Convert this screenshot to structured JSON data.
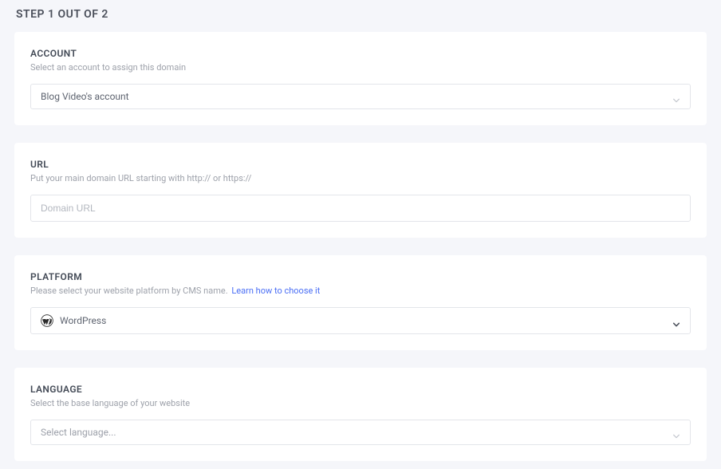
{
  "step_title": "STEP 1 OUT OF 2",
  "account": {
    "heading": "ACCOUNT",
    "subtext": "Select an account to assign this domain",
    "selected": "Blog Video's account"
  },
  "url": {
    "heading": "URL",
    "subtext": "Put your main domain URL starting with http:// or https://",
    "placeholder": "Domain URL"
  },
  "platform": {
    "heading": "PLATFORM",
    "subtext": "Please select your website platform by CMS name.",
    "link_text": "Learn how to choose it",
    "selected": "WordPress",
    "icon": "wordpress-icon"
  },
  "language": {
    "heading": "LANGUAGE",
    "subtext": "Select the base language of your website",
    "placeholder": "Select language..."
  }
}
